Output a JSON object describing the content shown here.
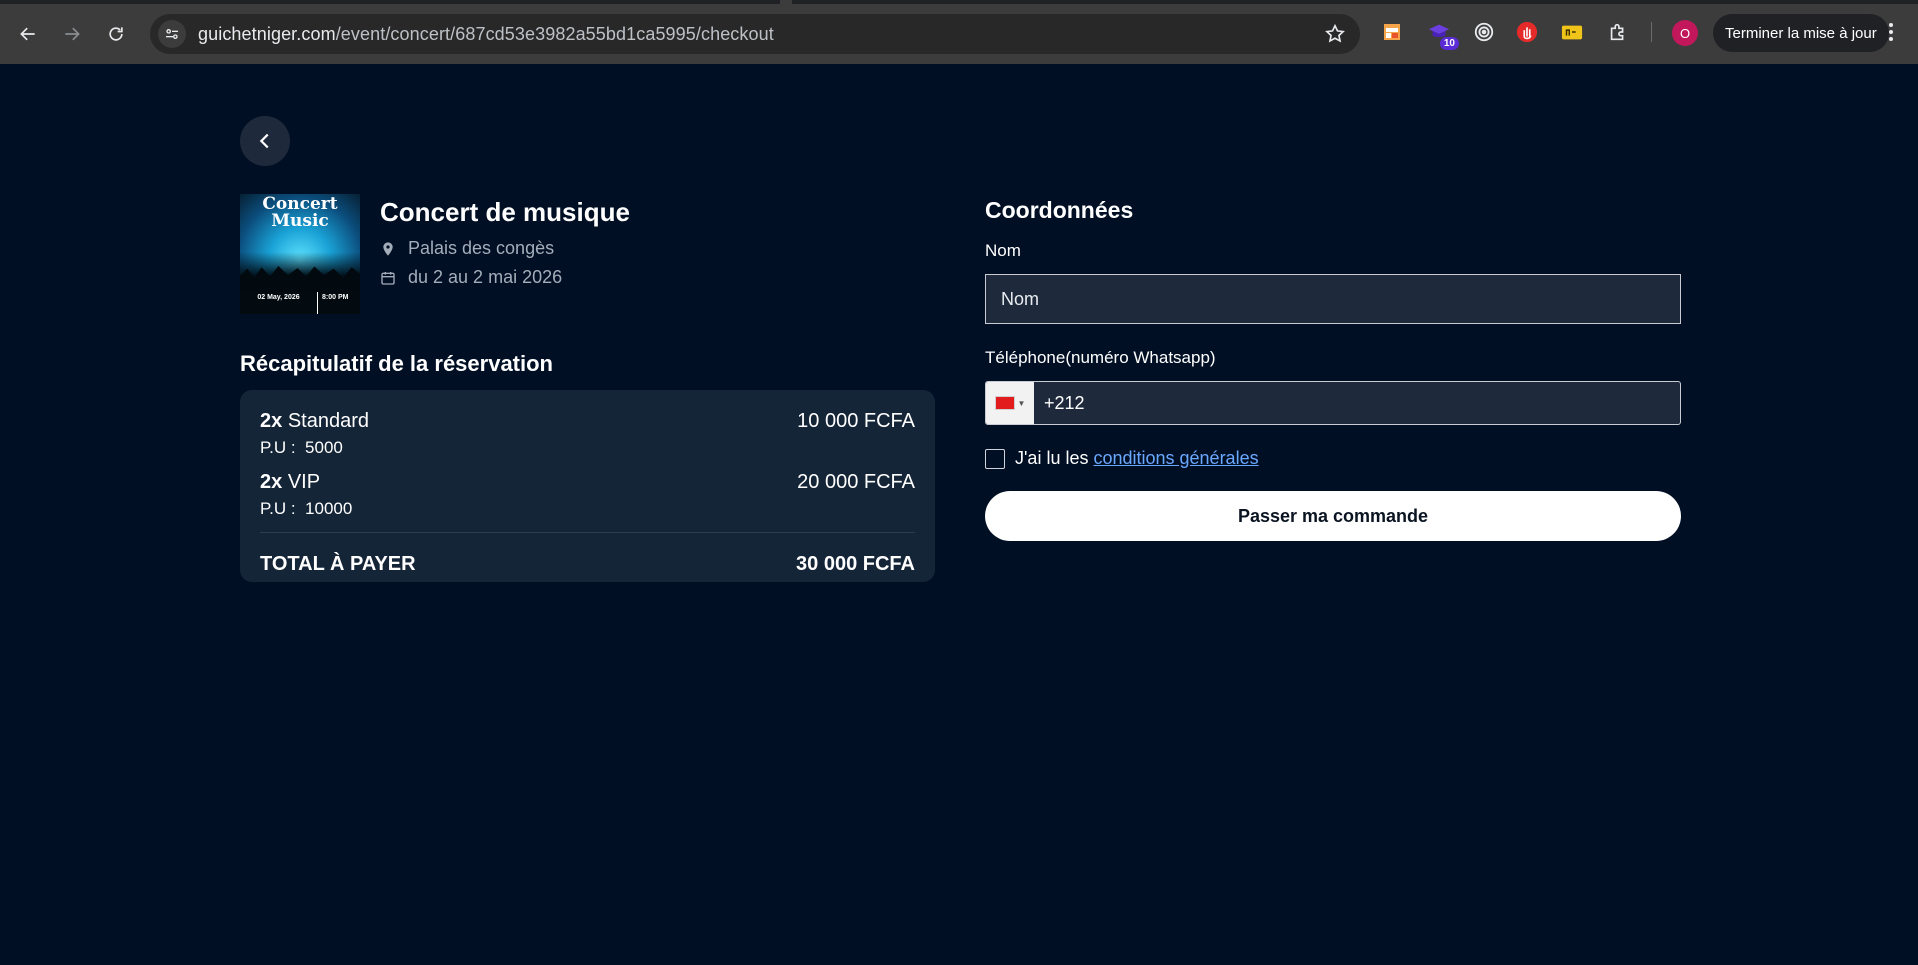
{
  "browser": {
    "url_host": "guichetniger.com",
    "url_path": "/event/concert/687cd53e3982a55bd1ca5995/checkout",
    "extension_badge": "10",
    "profile_initial": "O",
    "update_button": "Terminer la mise à jour"
  },
  "event": {
    "title": "Concert de musique",
    "location": "Palais des congès",
    "dates": "du 2 au 2 mai 2026",
    "poster": {
      "title": "Concert Music",
      "date": "02 May, 2026",
      "time": "8:00 PM"
    }
  },
  "recap": {
    "heading": "Récapitulatif de la réservation",
    "items": [
      {
        "qty": "2x",
        "name": "Standard",
        "price": "10 000 FCFA",
        "unit_label": "P.U :",
        "unit_price": "5000"
      },
      {
        "qty": "2x",
        "name": "VIP",
        "price": "20 000 FCFA",
        "unit_label": "P.U :",
        "unit_price": "10000"
      }
    ],
    "total_label": "TOTAL À PAYER",
    "total_value": "30 000 FCFA"
  },
  "form": {
    "heading": "Coordonnées",
    "name_label": "Nom",
    "name_placeholder": "Nom",
    "phone_label": "Téléphone(numéro Whatsapp)",
    "phone_value": "+212",
    "terms_text": "J'ai lu les",
    "terms_link": "conditions générales",
    "submit_label": "Passer ma commande"
  }
}
